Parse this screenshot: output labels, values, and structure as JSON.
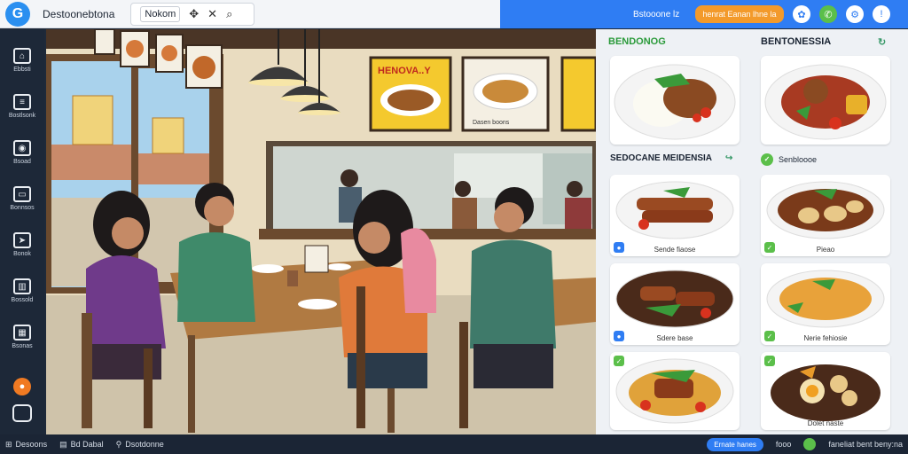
{
  "app": {
    "title": "Destoonebtona",
    "tool_label": "Nokom",
    "status_text": "Bstooone lz",
    "promo_label": "henrat Eanan lhne la",
    "colors": {
      "accent": "#2f7df3",
      "promo": "#f39a2b",
      "sidebar": "#1d2838"
    }
  },
  "toolbar_icons": [
    "move-icon",
    "close-icon",
    "search-icon"
  ],
  "sidebar": {
    "items": [
      {
        "label": "Ebbsti",
        "icon": "home-icon"
      },
      {
        "label": "Bostlsonk",
        "icon": "list-icon"
      },
      {
        "label": "Bsoad",
        "icon": "location-icon"
      },
      {
        "label": "Bonnsos",
        "icon": "chat-icon"
      },
      {
        "label": "Bonok",
        "icon": "send-icon"
      },
      {
        "label": "Bossold",
        "icon": "building-icon"
      },
      {
        "label": "Bsonas",
        "icon": "grid-icon"
      }
    ]
  },
  "scene": {
    "poster_left": "HENOVA..Y",
    "poster_caption": "Dasen boons"
  },
  "menu": {
    "header_left": "BENDONOG",
    "header_right": "BENTONESSIA",
    "section_left": "SEDOCANE MEIDENSIA",
    "section_right": "Senbloooe",
    "dishes": [
      {
        "caption": "",
        "badge": ""
      },
      {
        "caption": "",
        "badge": ""
      },
      {
        "caption": "Sende fiaose",
        "badge": "#2f7df3"
      },
      {
        "caption": "Pieao",
        "badge": "#5bbf4a"
      },
      {
        "caption": "Sdere base",
        "badge": "#2f7df3"
      },
      {
        "caption": "Nerie fehiosie",
        "badge": "#5bbf4a"
      },
      {
        "caption": "",
        "badge": "#5bbf4a"
      },
      {
        "caption": "Dolet naste",
        "badge": "#5bbf4a"
      }
    ]
  },
  "bottom": {
    "item1": "Desoons",
    "item2": "Bd Dabal",
    "item3": "Dsotdonne",
    "pill": "Ernate hanes",
    "right_label": "fooo",
    "right_text": "faneliat bent beny:na"
  }
}
